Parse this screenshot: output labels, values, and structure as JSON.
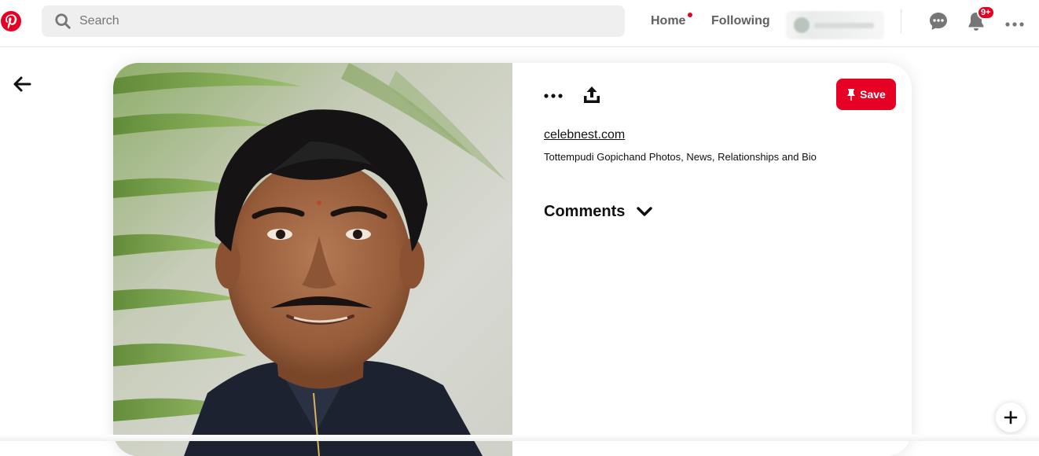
{
  "header": {
    "search": {
      "placeholder": "Search"
    },
    "nav": {
      "home": "Home",
      "following": "Following"
    },
    "notifications_badge": "9+"
  },
  "pin": {
    "save_label": "Save",
    "source": "celebnest.com",
    "description": "Tottempudi Gopichand Photos, News, Relationships and Bio",
    "comments_label": "Comments"
  },
  "colors": {
    "brand": "#e60023",
    "text_primary": "#111111",
    "nav_text": "#5f5f5f",
    "search_bg": "#efefef"
  },
  "icons": {
    "logo": "pinterest-logo",
    "search": "search-icon",
    "messages": "chat-bubble-icon",
    "notifications": "bell-icon",
    "menu": "more-horizontal-icon",
    "back": "arrow-left-icon",
    "share": "share-upload-icon",
    "pin": "pushpin-icon",
    "expand": "chevron-down-icon",
    "add": "plus-icon"
  }
}
